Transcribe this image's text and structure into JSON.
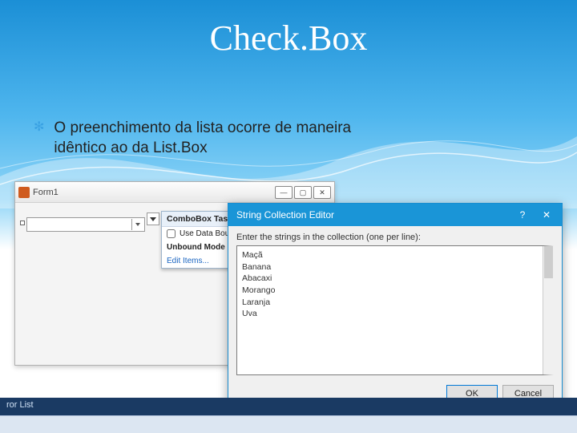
{
  "slide": {
    "title": "Check.Box",
    "bullet_mark": "✻",
    "bullet_text": "O preenchimento da lista ocorre de maneira idêntico ao da List.Box"
  },
  "form1": {
    "title": "Form1",
    "win_min": "—",
    "win_max": "▢",
    "win_close": "✕",
    "combo_placeholder": ""
  },
  "tasks_panel": {
    "header": "ComboBox Tasks",
    "use_data_bound": "Use Data Bound Items",
    "unbound_header": "Unbound Mode",
    "edit_items": "Edit Items..."
  },
  "editor": {
    "title": "String Collection Editor",
    "help": "?",
    "close": "✕",
    "prompt": "Enter the strings in the collection (one per line):",
    "lines": [
      "Maçã",
      "Banana",
      "Abacaxi",
      "Morango",
      "Laranja",
      "Uva"
    ],
    "ok": "OK",
    "cancel": "Cancel"
  },
  "statusbar": {
    "text": "ror List"
  }
}
